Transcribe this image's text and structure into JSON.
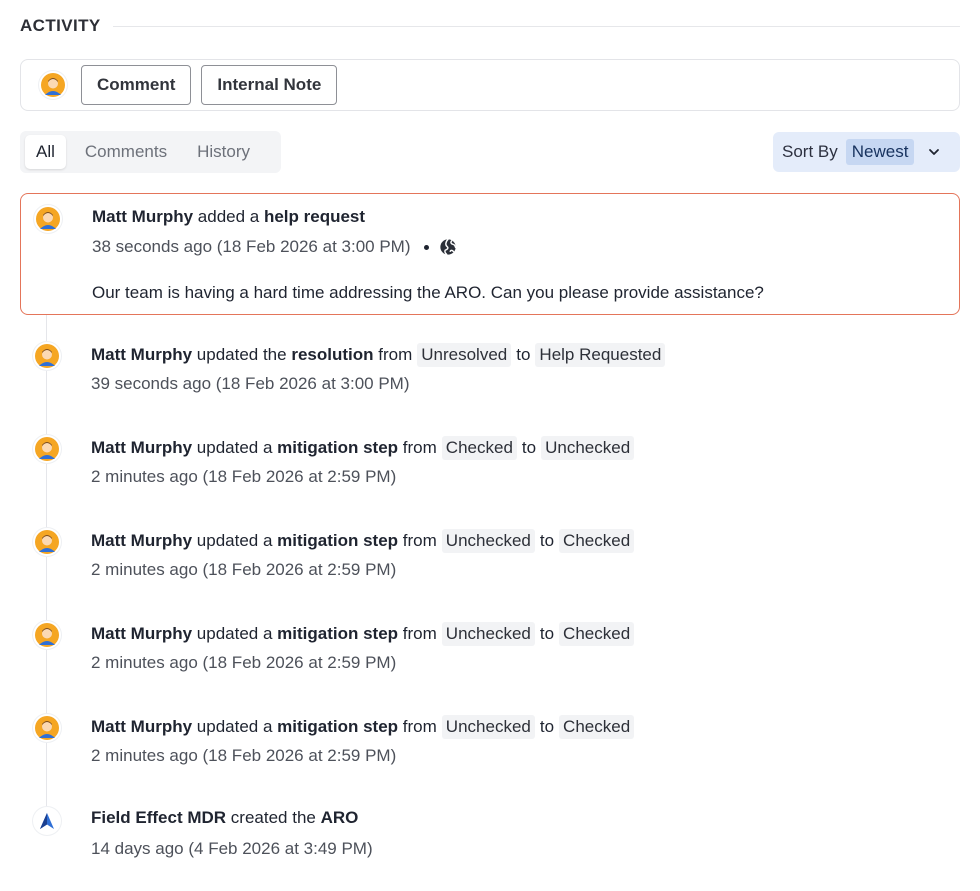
{
  "activity": {
    "title": "ACTIVITY"
  },
  "composer": {
    "comment_label": "Comment",
    "internal_note_label": "Internal Note"
  },
  "tabs": [
    {
      "label": "All"
    },
    {
      "label": "Comments"
    },
    {
      "label": "History"
    }
  ],
  "sort": {
    "label": "Sort By",
    "value": "Newest"
  },
  "colors": {
    "highlight_border": "#e4755a",
    "sort_bg": "#e4ecfa",
    "sort_value_bg": "#c6d7f2",
    "avatar_orange": "#f5a623",
    "avatar_blue": "#2f6fd6"
  },
  "entries": [
    {
      "actor": "Matt Murphy",
      "verb": "added a",
      "object": "help request",
      "time": "38 seconds ago (18 Feb 2026 at 3:00 PM)",
      "visibility_icon": "globe-icon",
      "body": "Our team is having a hard time addressing the ARO. Can you please provide assistance?"
    },
    {
      "actor": "Matt Murphy",
      "verb": "updated the",
      "object": "resolution",
      "from_word": "from",
      "from_value": "Unresolved",
      "to_word": "to",
      "to_value": "Help Requested",
      "time": "39 seconds ago (18 Feb 2026 at 3:00 PM)"
    },
    {
      "actor": "Matt Murphy",
      "verb": "updated a",
      "object": "mitigation step",
      "from_word": "from",
      "from_value": "Checked",
      "to_word": "to",
      "to_value": "Unchecked",
      "time": "2 minutes ago (18 Feb 2026 at 2:59 PM)"
    },
    {
      "actor": "Matt Murphy",
      "verb": "updated a",
      "object": "mitigation step",
      "from_word": "from",
      "from_value": "Unchecked",
      "to_word": "to",
      "to_value": "Checked",
      "time": "2 minutes ago (18 Feb 2026 at 2:59 PM)"
    },
    {
      "actor": "Matt Murphy",
      "verb": "updated a",
      "object": "mitigation step",
      "from_word": "from",
      "from_value": "Unchecked",
      "to_word": "to",
      "to_value": "Checked",
      "time": "2 minutes ago (18 Feb 2026 at 2:59 PM)"
    },
    {
      "actor": "Matt Murphy",
      "verb": "updated a",
      "object": "mitigation step",
      "from_word": "from",
      "from_value": "Unchecked",
      "to_word": "to",
      "to_value": "Checked",
      "time": "2 minutes ago (18 Feb 2026 at 2:59 PM)"
    },
    {
      "actor": "Field Effect MDR",
      "verb": "created the",
      "object": "ARO",
      "time": "14 days ago (4 Feb 2026 at 3:49 PM)"
    }
  ]
}
